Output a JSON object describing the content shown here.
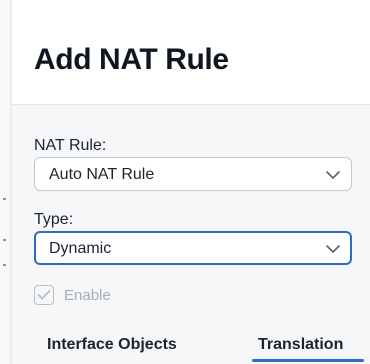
{
  "dialog": {
    "title": "Add NAT Rule"
  },
  "nat_rule": {
    "label": "NAT Rule:",
    "value": "Auto NAT Rule"
  },
  "type": {
    "label": "Type:",
    "value": "Dynamic"
  },
  "enable": {
    "label": "Enable",
    "checked": true,
    "disabled": true
  },
  "tabs": [
    {
      "label": "Interface Objects",
      "active": false
    },
    {
      "label": "Translation",
      "active": true
    }
  ],
  "colors": {
    "accent": "#2f6bc1",
    "disabled_text": "#a8adb4"
  },
  "icons": {
    "dropdown": "chevron-down-icon",
    "check": "checkmark-icon"
  }
}
